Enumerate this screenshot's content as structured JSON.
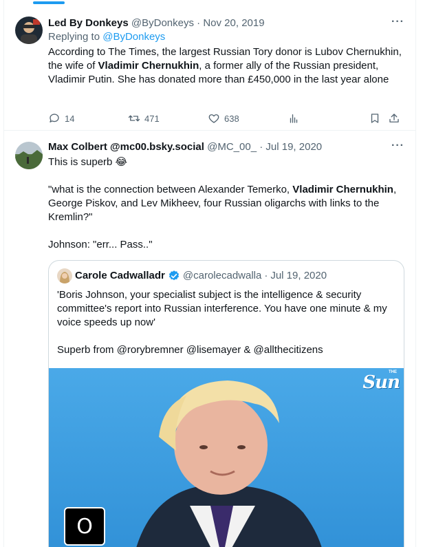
{
  "tweet1": {
    "name": "Led By Donkeys",
    "handle": "@ByDonkeys",
    "dot": "·",
    "date": "Nov 20, 2019",
    "more": "···",
    "replying_prefix": "Replying to ",
    "replying_handle": "@ByDonkeys",
    "text_1": "According to The Times, the largest Russian Tory donor is Lubov Chernukhin, the wife of ",
    "text_bold": "Vladimir Chernukhin",
    "text_2": ", a former ally of the Russian president, Vladimir Putin. She has donated more than £450,000 in the last year alone",
    "replies": "14",
    "retweets": "471",
    "likes": "638"
  },
  "tweet2": {
    "name": "Max Colbert @mc00.bsky.social",
    "handle": "@MC_00_",
    "dot": "·",
    "date": "Jul 19, 2020",
    "more": "···",
    "line1": "This is superb 😂",
    "q_open": "\"what is the connection between Alexander Temerko, ",
    "q_bold1": "Vladimir Chernukhin",
    "q_mid": ", George Piskov, and Lev Mikheev, four Russian oligarchs with links to the Kremlin?\"",
    "line3": "Johnson: \"err... Pass..\""
  },
  "quote": {
    "name": "Carole Cadwalladr",
    "handle": "@carolecadwalla",
    "dot": "·",
    "date": "Jul 19, 2020",
    "text_1": "'Boris Johnson, your specialist subject is the intelligence & security committee's report into Russian interference. You have one minute & my voice speeds up now'",
    "text_2": "Superb from @rorybremner @lisemayer & @allthecitizens",
    "media_logo": "Sun",
    "media_logo_small": "THE",
    "media_badge": "O"
  },
  "colors": {
    "accent": "#1d9bf0",
    "muted": "#536471",
    "border": "#cfd9de"
  }
}
